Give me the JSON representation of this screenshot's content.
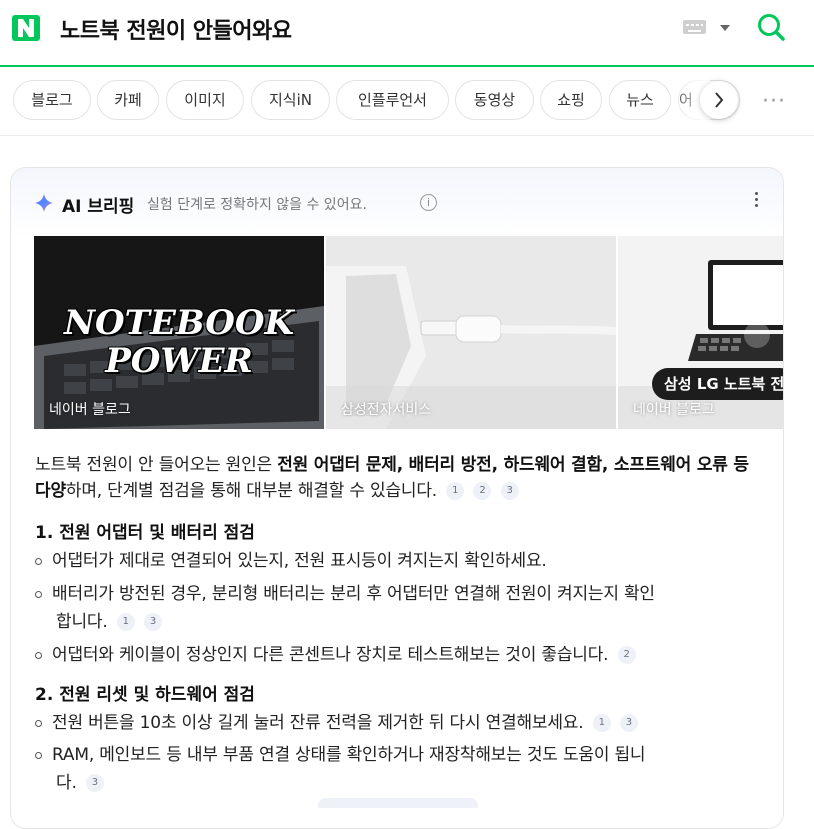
{
  "header": {
    "logo_letter": "N",
    "query": "노트북 전원이 안들어와요",
    "brand_color": "#03c75a"
  },
  "tabs": [
    "블로그",
    "카페",
    "이미지",
    "지식iN",
    "인플루언서",
    "동영상",
    "쇼핑",
    "뉴스",
    "어"
  ],
  "ai_card": {
    "title": "AI 브리핑",
    "subtitle": "실험 단계로 정확하지 않을 수 있어요.",
    "info_glyph": "i",
    "images": [
      {
        "label": "네이버 블로그",
        "overlay_line1": "NOTEBOOK",
        "overlay_line2": "POWER"
      },
      {
        "label": "삼성전자서비스"
      },
      {
        "label": "네이버 블로그",
        "caption": "삼성 LG 노트북 전"
      }
    ],
    "answer": {
      "intro": "노트북 전원이 안 들어오는 원인은 ",
      "bold": "전원 어댑터 문제, 배터리 방전, 하드웨어 결함, 소프트웨어 오류 등 다양",
      "rest": "하며, 단계별 점검을 통해 대부분 해결할 수 있습니다.",
      "cites": [
        "1",
        "2",
        "3"
      ]
    },
    "sections": [
      {
        "heading": "1. 전원 어댑터 및 배터리 점검",
        "items": [
          {
            "text": "어댑터가 제대로 연결되어 있는지, 전원 표시등이 켜지는지 확인하세요.",
            "cites": []
          },
          {
            "line1": "배터리가 방전된 경우, 분리형 배터리는 분리 후 어댑터만 연결해 전원이 켜지는지 확인",
            "line2": "합니다.",
            "cites": [
              "1",
              "3"
            ]
          },
          {
            "text": "어댑터와 케이블이 정상인지 다른 콘센트나 장치로 테스트해보는 것이 좋습니다.",
            "cites": [
              "2"
            ]
          }
        ]
      },
      {
        "heading": "2. 전원 리셋 및 하드웨어 점검",
        "items": [
          {
            "text": "전원 버튼을 10초 이상 길게 눌러 잔류 전력을 제거한 뒤 다시 연결해보세요.",
            "cites": [
              "1",
              "3"
            ]
          },
          {
            "line1": "RAM, 메인보드 등 내부 부품 연결 상태를 확인하거나 재장착해보는 것도 도움이 됩니",
            "line2": "다.",
            "cites": [
              "3"
            ]
          }
        ]
      }
    ]
  }
}
